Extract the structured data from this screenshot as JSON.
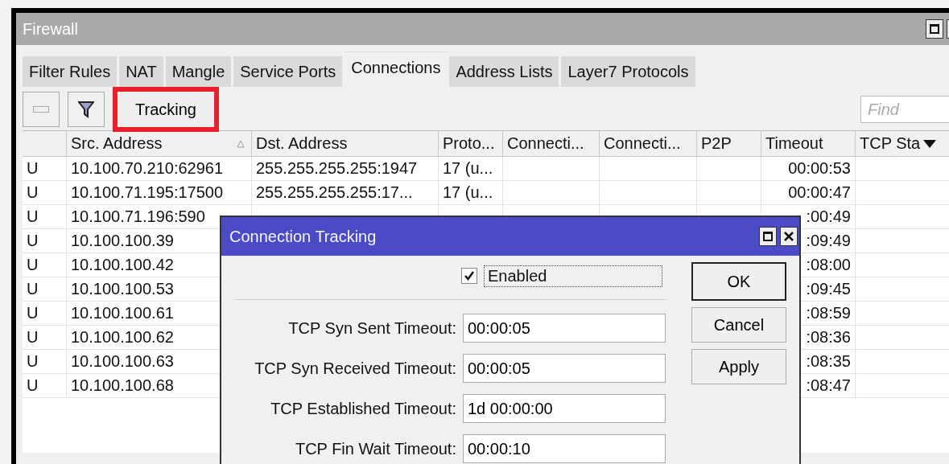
{
  "window": {
    "title": "Firewall"
  },
  "tabs": [
    {
      "label": "Filter Rules",
      "selected": false
    },
    {
      "label": "NAT",
      "selected": false
    },
    {
      "label": "Mangle",
      "selected": false
    },
    {
      "label": "Service Ports",
      "selected": false
    },
    {
      "label": "Connections",
      "selected": true
    },
    {
      "label": "Address Lists",
      "selected": false
    },
    {
      "label": "Layer7 Protocols",
      "selected": false
    }
  ],
  "toolbar": {
    "tracking_button": {
      "label": "Tracking",
      "highlighted": true
    },
    "find": {
      "placeholder": "Find"
    }
  },
  "table": {
    "columns": [
      {
        "sorted": false
      },
      {
        "label": "Src. Address",
        "sorted": true
      },
      {
        "label": "Dst. Address",
        "sorted": false
      },
      {
        "label": "Proto...",
        "sorted": false
      },
      {
        "label": "Connecti...",
        "sorted": false
      },
      {
        "label": "Connecti...",
        "sorted": false
      },
      {
        "label": "P2P",
        "sorted": false
      },
      {
        "label": "Timeout",
        "sorted": false
      },
      {
        "label": "TCP Sta",
        "sorted": false
      }
    ],
    "rows": [
      {
        "flag": "U",
        "src": "10.100.70.210:62961",
        "dst": "255.255.255.255:1947",
        "proto": "17 (u...",
        "timeout": "00:00:53"
      },
      {
        "flag": "U",
        "src": "10.100.71.195:17500",
        "dst": "255.255.255.255:17...",
        "proto": "17 (u...",
        "timeout": "00:00:47"
      },
      {
        "flag": "U",
        "src": "10.100.71.196:590",
        "timeout": ":00:49"
      },
      {
        "flag": "U",
        "src": "10.100.100.39",
        "timeout": ":09:49"
      },
      {
        "flag": "U",
        "src": "10.100.100.42",
        "timeout": ":08:00"
      },
      {
        "flag": "U",
        "src": "10.100.100.53",
        "timeout": ":09:45"
      },
      {
        "flag": "U",
        "src": "10.100.100.61",
        "timeout": ":08:59"
      },
      {
        "flag": "U",
        "src": "10.100.100.62",
        "timeout": ":08:36"
      },
      {
        "flag": "U",
        "src": "10.100.100.63",
        "timeout": ":08:35"
      },
      {
        "flag": "U",
        "src": "10.100.100.68",
        "timeout": ":08:47"
      }
    ]
  },
  "dialog": {
    "title": "Connection Tracking",
    "enabled": {
      "label": "Enabled",
      "checked": true
    },
    "fields": [
      {
        "label": "TCP Syn Sent Timeout:",
        "value": "00:00:05"
      },
      {
        "label": "TCP Syn Received Timeout:",
        "value": "00:00:05"
      },
      {
        "label": "TCP Established Timeout:",
        "value": "1d 00:00:00"
      },
      {
        "label": "TCP Fin Wait Timeout:",
        "value": "00:00:10"
      }
    ],
    "buttons": [
      {
        "label": "OK",
        "default": true
      },
      {
        "label": "Cancel",
        "default": false
      },
      {
        "label": "Apply",
        "default": false
      }
    ]
  }
}
